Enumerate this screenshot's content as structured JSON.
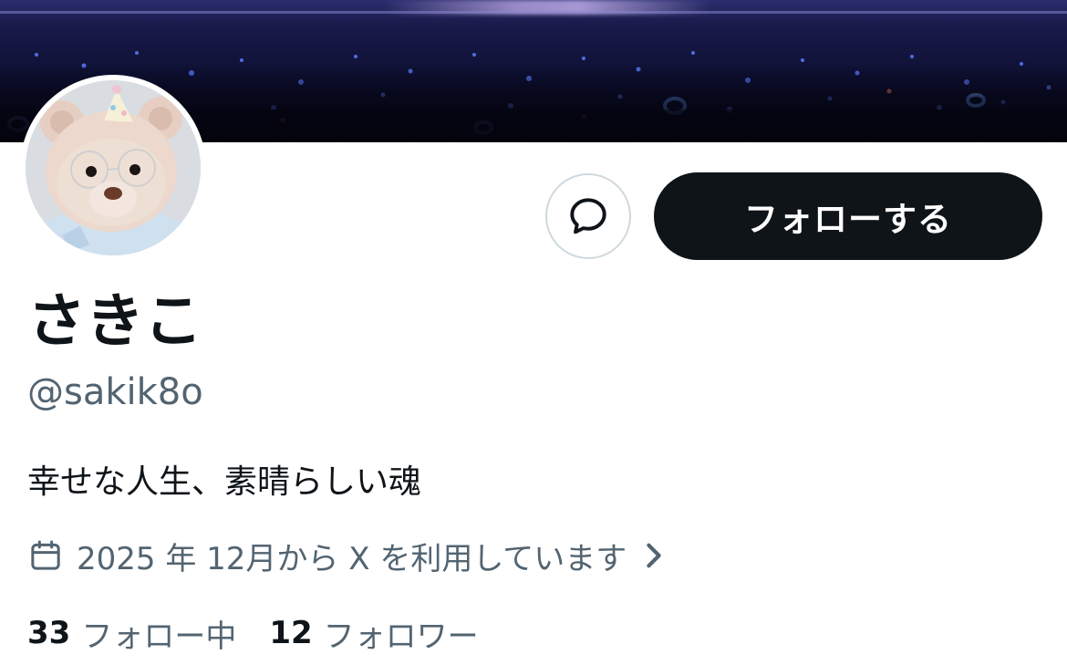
{
  "profile": {
    "display_name": "さきこ",
    "handle": "@sakik8o",
    "bio": "幸せな人生、素晴らしい魂",
    "joined_text": "2025 年 12月から X を利用しています"
  },
  "actions": {
    "follow_label": "フォローする",
    "message_icon": "message-bubble-icon"
  },
  "stats": {
    "following_count": "33",
    "following_label": "フォロー中",
    "followers_count": "12",
    "followers_label": "フォロワー"
  },
  "icons": {
    "calendar": "calendar-icon",
    "chevron": "chevron-right-icon"
  },
  "colors": {
    "text_primary": "#0f1419",
    "text_secondary": "#536471",
    "button_dark": "#0f1419",
    "border": "#cfd9de"
  }
}
